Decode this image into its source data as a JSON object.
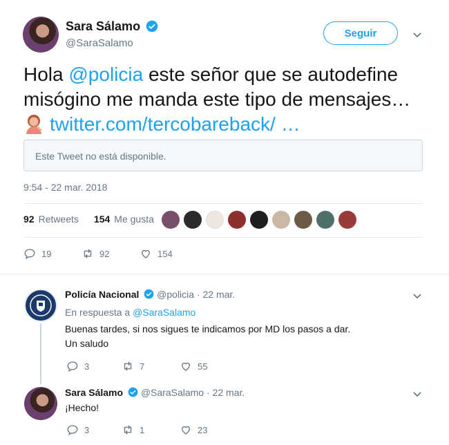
{
  "main_tweet": {
    "author_name": "Sara Sálamo",
    "author_handle": "@SaraSalamo",
    "follow_label": "Seguir",
    "text_before": "Hola ",
    "mention": "@policia",
    "text_after": " este señor que se autodefine misógino me manda este tipo de mensajes…",
    "link": "twitter.com/tercobareback/ …",
    "quote_unavailable": "Este Tweet no está disponible.",
    "timestamp": "9:54 - 22 mar. 2018",
    "retweets_count": "92",
    "retweets_label": "Retweets",
    "likes_count": "154",
    "likes_label": "Me gusta",
    "actions": {
      "replies": "19",
      "retweets": "92",
      "likes": "154"
    }
  },
  "reply_police": {
    "name": "Policía Nacional",
    "handle": "@policia",
    "date": "· 22 mar.",
    "in_reply_prefix": "En respuesta a ",
    "in_reply_handle": "@SaraSalamo",
    "body_line1": "Buenas tardes, si nos sigues te indicamos por MD los pasos a dar.",
    "body_line2": "Un saludo",
    "actions": {
      "replies": "3",
      "retweets": "7",
      "likes": "55"
    }
  },
  "reply_sara": {
    "name": "Sara Sálamo",
    "handle": "@SaraSalamo",
    "date": "· 22 mar.",
    "body": "¡Hecho!",
    "actions": {
      "replies": "3",
      "retweets": "1",
      "likes": "23"
    }
  },
  "colors": {
    "accent": "#1da1f2",
    "text": "#14171a",
    "muted": "#657786",
    "border": "#e6ecf0"
  },
  "icons": [
    "verified-badge-icon",
    "chevron-down-icon",
    "reply-icon",
    "retweet-icon",
    "heart-icon",
    "shield-icon",
    "emoji-woman-icon"
  ]
}
